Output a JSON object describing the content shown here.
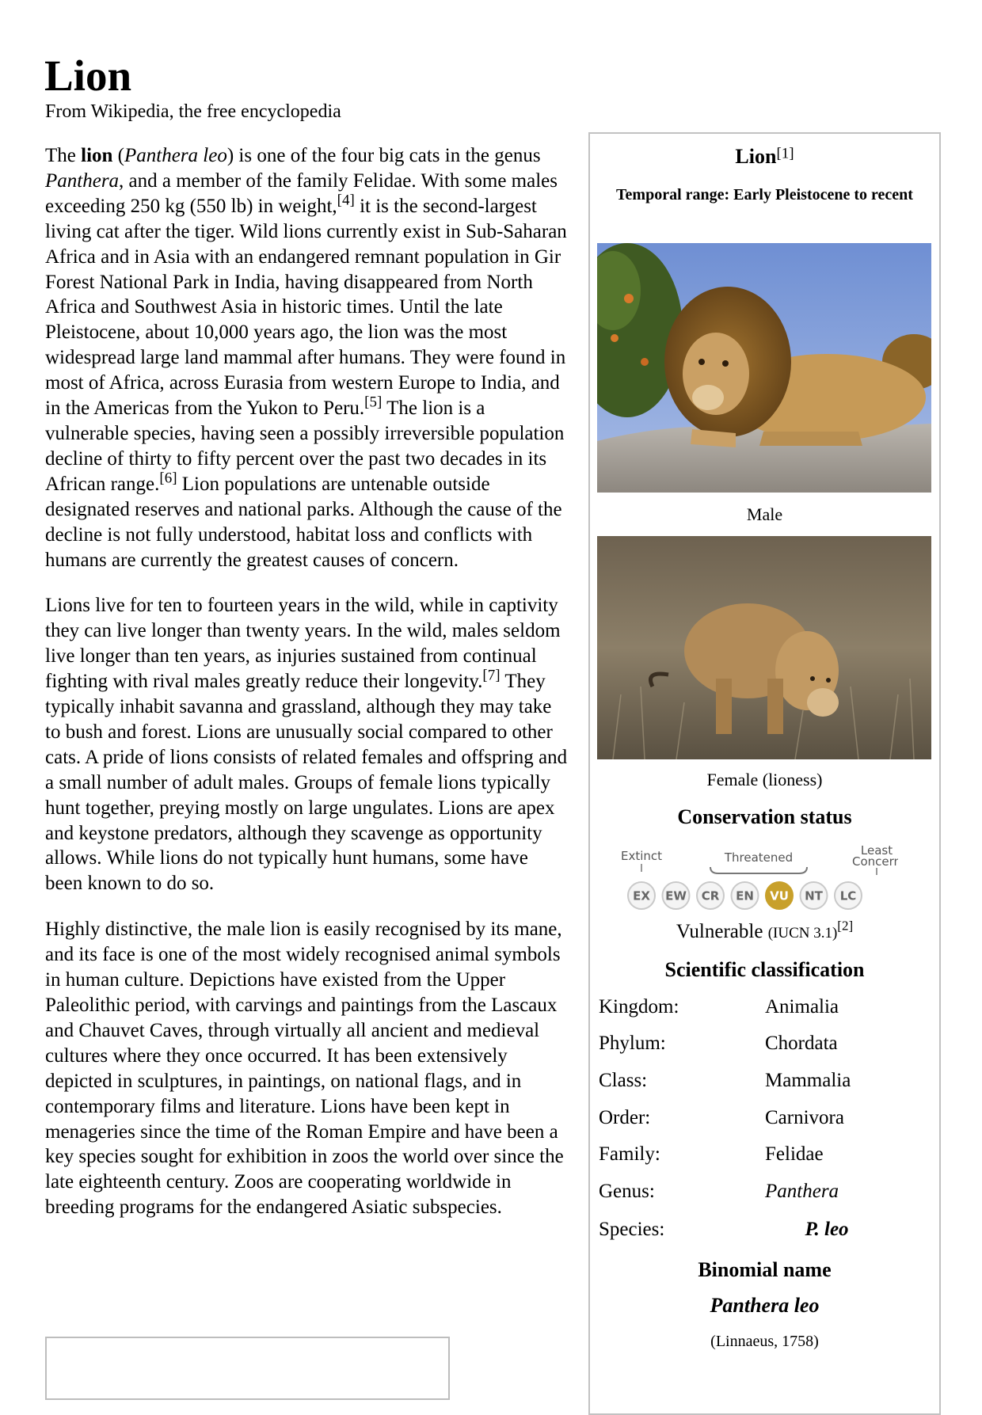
{
  "title": "Lion",
  "subtitle": "From Wikipedia, the free encyclopedia",
  "article": {
    "p1": {
      "t1": "The ",
      "bold": "lion",
      "t2": " (",
      "italic1": "Panthera leo",
      "t3": ") is one of the four big cats in the genus ",
      "italic2": "Panthera",
      "t4": ", and a member of the family Felidae. With some males exceeding 250 kg (550 lb) in weight,",
      "ref4": "[4]",
      "t5": " it is the second-largest living cat after the tiger. Wild lions currently exist in Sub-Saharan Africa and in Asia with an endangered remnant population in Gir Forest National Park in India, having disappeared from North Africa and Southwest Asia in historic times. Until the late Pleistocene, about 10,000 years ago, the lion was the most widespread large land mammal after humans. They were found in most of Africa, across Eurasia from western Europe to India, and in the Americas from the Yukon to Peru.",
      "ref5": "[5]",
      "t6": " The lion is a vulnerable species, having seen a possibly irreversible population decline of thirty to fifty percent over the past two decades in its African range.",
      "ref6": "[6]",
      "t7": " Lion populations are untenable outside designated reserves and national parks. Although the cause of the decline is not fully understood, habitat loss and conflicts with humans are currently the greatest causes of concern."
    },
    "p2": {
      "t1": "Lions live for ten to fourteen years in the wild, while in captivity they can live longer than twenty years. In the wild, males seldom live longer than ten years, as injuries sustained from continual fighting with rival males greatly reduce their longevity.",
      "ref7": "[7]",
      "t2": " They typically inhabit savanna and grassland, although they may take to bush and forest. Lions are unusually social compared to other cats. A pride of lions consists of related females and offspring and a small number of adult males. Groups of female lions typically hunt together, preying mostly on large ungulates. Lions are apex and keystone predators, although they scavenge as opportunity allows. While lions do not typically hunt humans, some have been known to do so."
    },
    "p3": "Highly distinctive, the male lion is easily recognised by its mane, and its face is one of the most widely recognised animal symbols in human culture. Depictions have existed from the Upper Paleolithic period, with carvings and paintings from the Lascaux and Chauvet Caves, through virtually all ancient and medieval cultures where they once occurred. It has been extensively depicted in sculptures, in paintings, on national flags, and in contemporary films and literature. Lions have been kept in menageries since the time of the Roman Empire and have been a key species sought for exhibition in zoos the world over since the late eighteenth century. Zoos are cooperating worldwide in breeding programs for the endangered Asiatic subspecies."
  },
  "infobox": {
    "title": "Lion",
    "title_ref": "[1]",
    "temporal_range": "Temporal range: Early Pleistocene to recent",
    "caption_male": "Male",
    "caption_female": "Female (lioness)",
    "conservation_heading": "Conservation status",
    "status_scale": {
      "label_extinct": "Extinct",
      "label_threatened": "Threatened",
      "label_least_1": "Least",
      "label_least_2": "Concern",
      "codes": [
        "EX",
        "EW",
        "CR",
        "EN",
        "VU",
        "NT",
        "LC"
      ],
      "selected": "VU",
      "selected_color": "#c8a02a"
    },
    "status": "Vulnerable",
    "status_source": "(IUCN 3.1)",
    "status_ref": "[2]",
    "classification_heading": "Scientific classification",
    "classification": [
      {
        "rank": "Kingdom:",
        "name": "Animalia"
      },
      {
        "rank": "Phylum:",
        "name": "Chordata"
      },
      {
        "rank": "Class:",
        "name": "Mammalia"
      },
      {
        "rank": "Order:",
        "name": "Carnivora"
      },
      {
        "rank": "Family:",
        "name": "Felidae"
      },
      {
        "rank": "Genus:",
        "name": "Panthera"
      },
      {
        "rank": "Species:",
        "name": "P. leo"
      }
    ],
    "binomial_heading": "Binomial name",
    "binomial_name": "Panthera leo",
    "binomial_authority": "(Linnaeus, 1758)"
  }
}
